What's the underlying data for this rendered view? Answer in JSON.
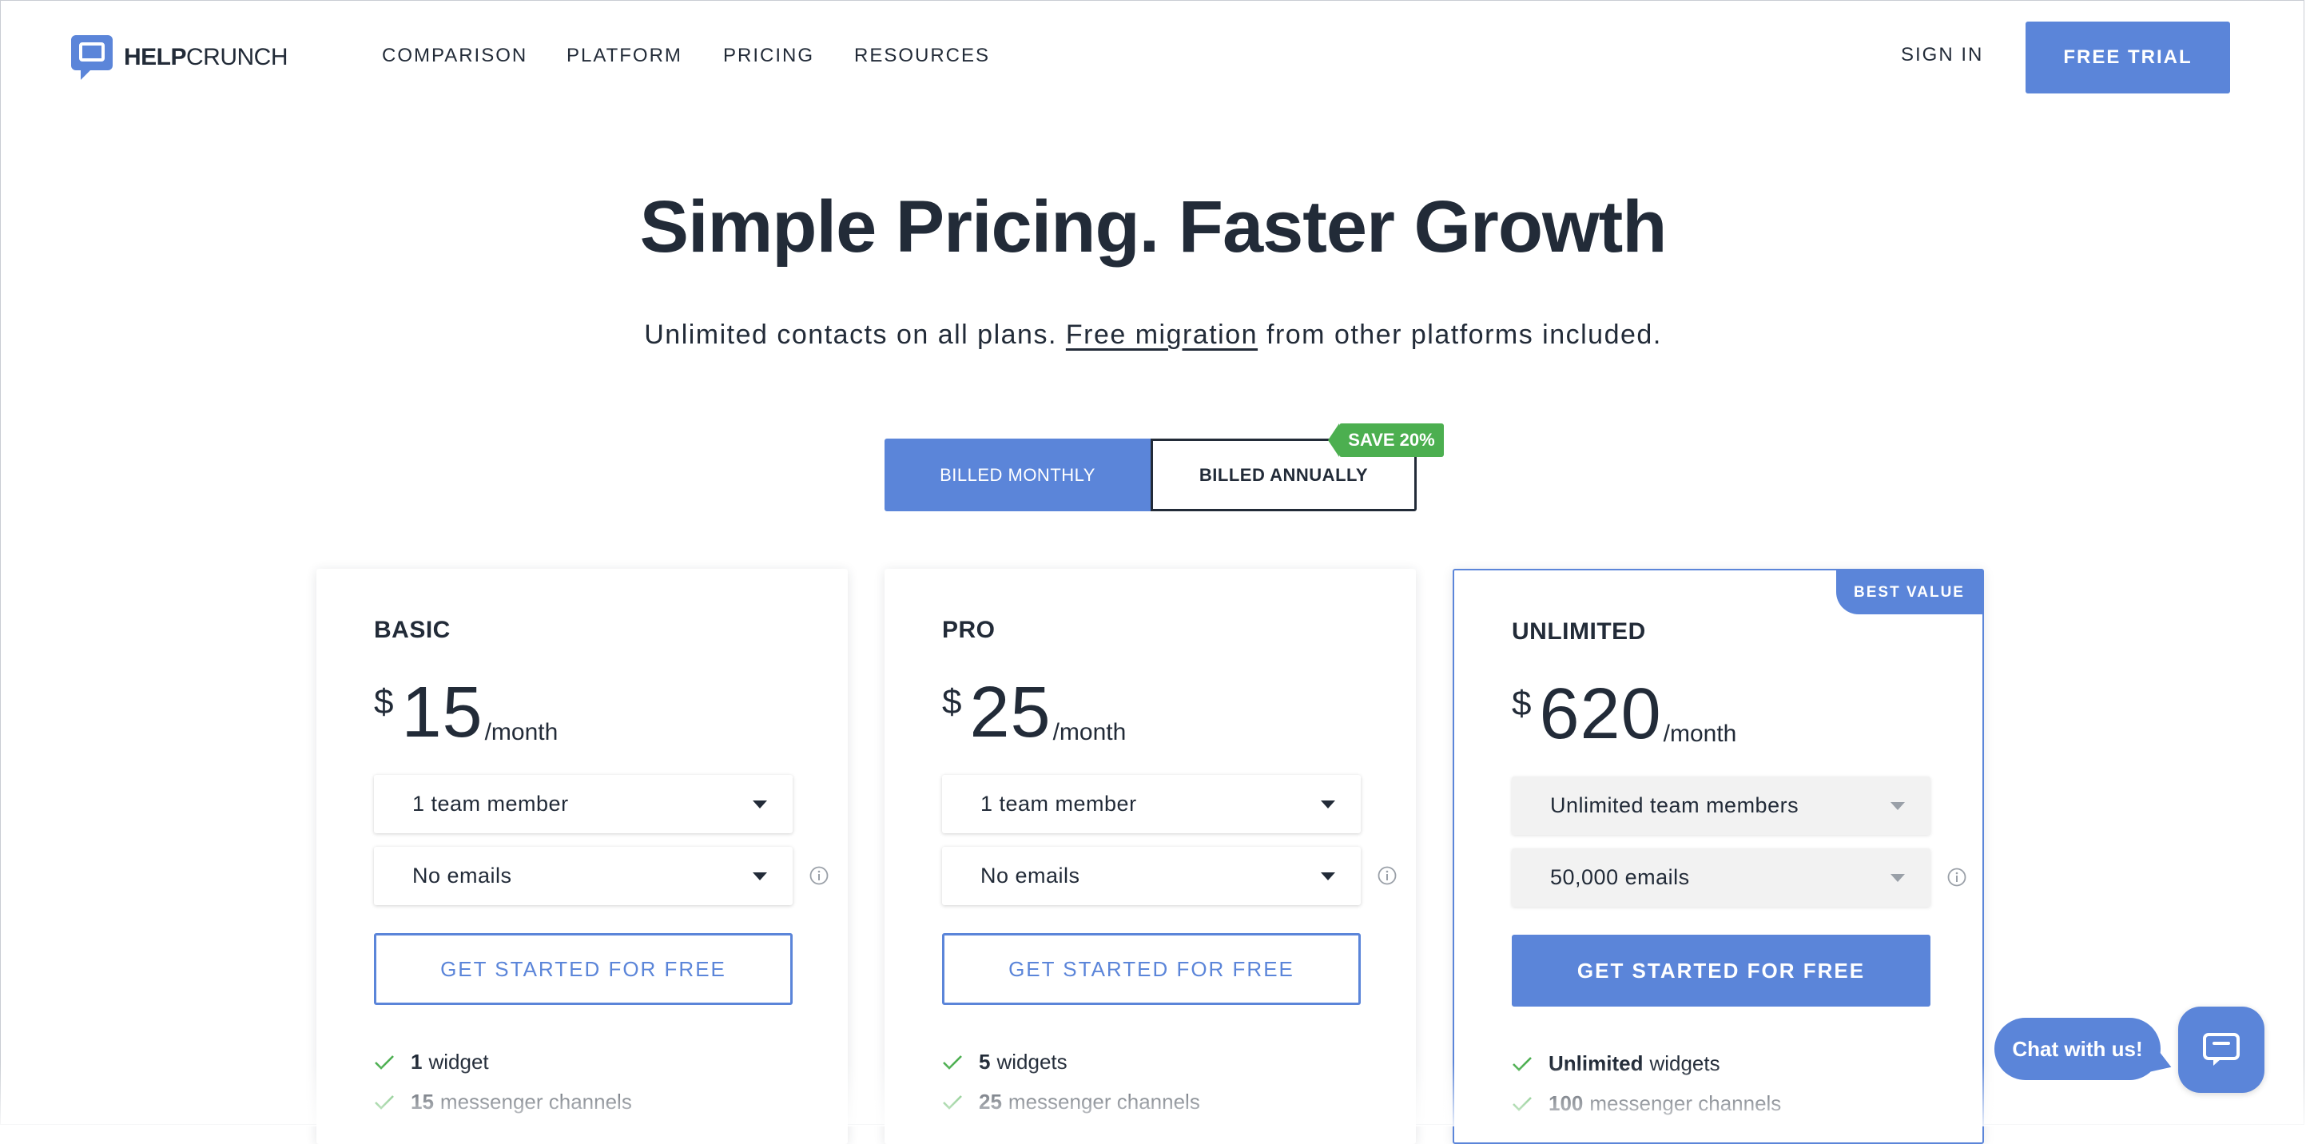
{
  "brand": {
    "bold": "HELP",
    "light": "CRUNCH",
    "color": "#5b85d9"
  },
  "nav": {
    "items": [
      "COMPARISON",
      "PLATFORM",
      "PRICING",
      "RESOURCES"
    ],
    "sign_in": "SIGN IN",
    "trial": "FREE TRIAL"
  },
  "hero": {
    "title": "Simple Pricing. Faster Growth",
    "sub_before": "Unlimited contacts on all plans. ",
    "sub_link": "Free migration",
    "sub_after": " from other platforms included."
  },
  "billing": {
    "monthly": "BILLED MONTHLY",
    "annual": "BILLED ANNUALLY",
    "save_badge": "SAVE 20%"
  },
  "plans": [
    {
      "name": "BASIC",
      "currency": "$",
      "price": "15",
      "period": "/month",
      "team": "1 team member",
      "emails": "No emails",
      "cta": "GET STARTED FOR FREE",
      "features": [
        {
          "bold": "1",
          "text": "widget"
        },
        {
          "bold": "15",
          "text": "messenger channels"
        }
      ]
    },
    {
      "name": "PRO",
      "currency": "$",
      "price": "25",
      "period": "/month",
      "team": "1 team member",
      "emails": "No emails",
      "cta": "GET STARTED FOR FREE",
      "features": [
        {
          "bold": "5",
          "text": "widgets"
        },
        {
          "bold": "25",
          "text": "messenger channels"
        }
      ]
    },
    {
      "name": "UNLIMITED",
      "currency": "$",
      "price": "620",
      "period": "/month",
      "team": "Unlimited team members",
      "emails": "50,000 emails",
      "cta": "GET STARTED FOR FREE",
      "badge": "BEST VALUE",
      "features": [
        {
          "bold": "Unlimited",
          "text": "widgets"
        },
        {
          "bold": "100",
          "text": "messenger channels"
        }
      ]
    }
  ],
  "chat": {
    "label": "Chat with us!"
  },
  "colors": {
    "accent": "#5b85d9",
    "success": "#4caf50",
    "text": "#222b38"
  }
}
